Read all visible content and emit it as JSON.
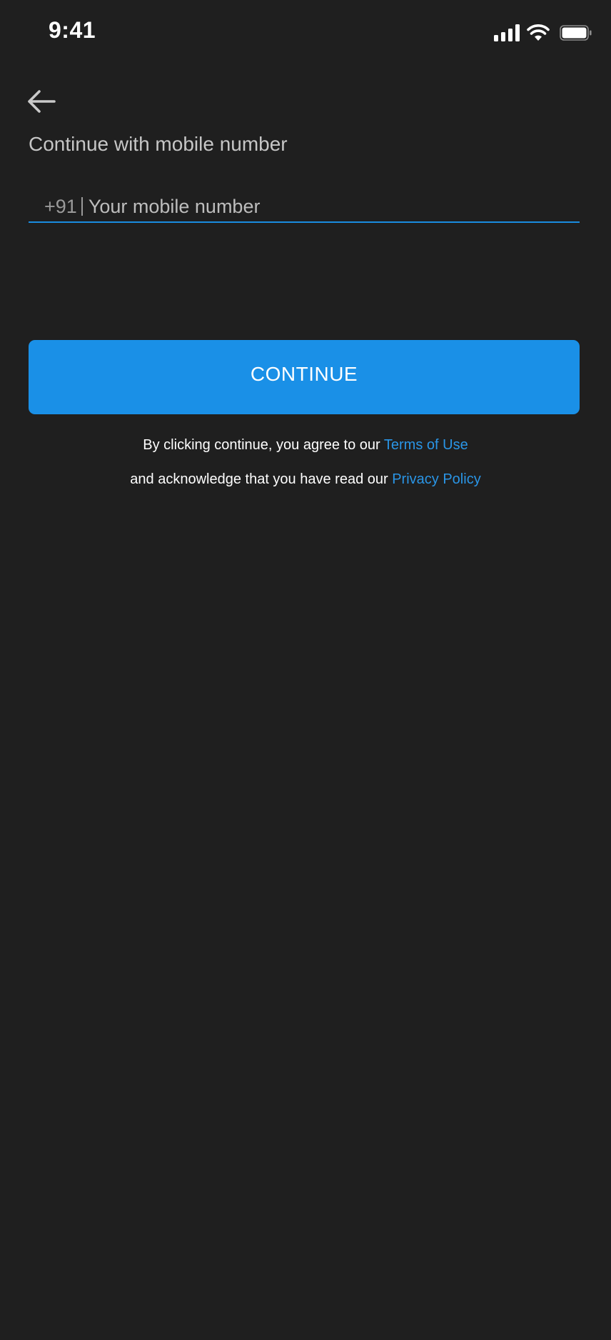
{
  "status_bar": {
    "time": "9:41",
    "icons": [
      "cellular-signal-icon",
      "wifi-icon",
      "battery-icon"
    ]
  },
  "header": {
    "back_icon": "arrow-left-icon",
    "title": "Continue with mobile number"
  },
  "phone_field": {
    "country_code": "+91",
    "value": "",
    "placeholder": "Your mobile number"
  },
  "continue_button": {
    "label": "CONTINUE"
  },
  "legal": {
    "line1_text": "By clicking continue, you agree to our ",
    "terms_link": "Terms of Use",
    "line2_text": "and acknowledge that you have read our ",
    "privacy_link": "Privacy Policy"
  },
  "colors": {
    "background": "#1f1f1f",
    "accent": "#1a90e7",
    "link": "#2a95e6",
    "title_text": "#c6c6c6"
  }
}
